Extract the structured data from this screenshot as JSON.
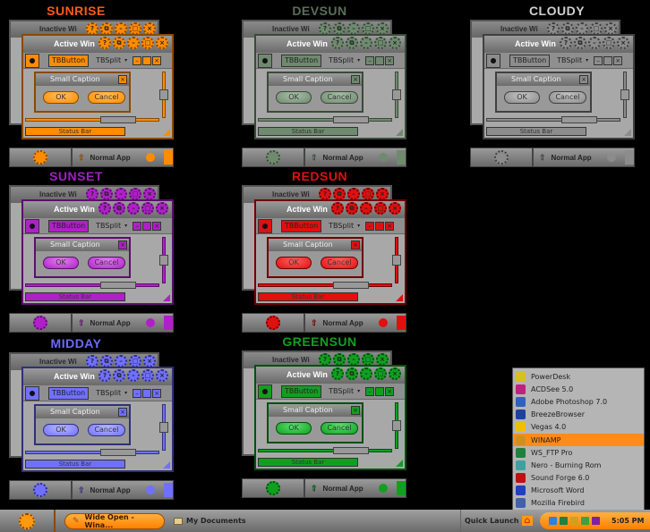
{
  "common": {
    "inactive_title": "Inactive Wi",
    "active_title": "Active Win",
    "tb_button": "TBButton",
    "tb_split": "TBSplit",
    "tb_split_arrow": "▾",
    "small_caption": "Small Caption",
    "ok": "OK",
    "cancel": "Cancel",
    "status_bar": "Status Bar",
    "normal_app": "Normal App",
    "gear_glyphs": [
      "?",
      "⧉",
      "–",
      "□",
      "×"
    ],
    "mini_glyphs": [
      "–",
      "",
      "×"
    ],
    "dialog_close": "×",
    "up_arrow": "⇧",
    "scroll_h_left": "⇦",
    "scroll_h_right": "⇨"
  },
  "themes": [
    {
      "name": "SUNRISE",
      "accent": "#ff8c00",
      "accent_light": "#ffc060",
      "accent_dark": "#8a4a00",
      "title_color": "#ff5a1a"
    },
    {
      "name": "DEVSUN",
      "accent": "#6f8a6f",
      "accent_light": "#a8c0a8",
      "accent_dark": "#3a4a3a",
      "title_color": "#5a6e5a"
    },
    {
      "name": "CLOUDY",
      "accent": "#8c8c8c",
      "accent_light": "#c4c4c4",
      "accent_dark": "#404040",
      "title_color": "#d0d0d0"
    },
    {
      "name": "SUNSET",
      "accent": "#b020c8",
      "accent_light": "#e080f0",
      "accent_dark": "#5a106a",
      "title_color": "#a020c0"
    },
    {
      "name": "REDSUN",
      "accent": "#e01010",
      "accent_light": "#ff6060",
      "accent_dark": "#700000",
      "title_color": "#e01010"
    },
    {
      "name": "MIDDAY",
      "accent": "#7070ff",
      "accent_light": "#b8b8ff",
      "accent_dark": "#30307a",
      "title_color": "#6a6aff"
    },
    {
      "name": "GREENSUN",
      "accent": "#10a020",
      "accent_light": "#60e070",
      "accent_dark": "#005010",
      "title_color": "#10a020"
    }
  ],
  "start_menu": {
    "items": [
      {
        "label": "PowerDesk",
        "icon": "powerdesk-icon",
        "color": "#d8c020"
      },
      {
        "label": "ACDSee 5.0",
        "icon": "acdsee-icon",
        "color": "#c02080"
      },
      {
        "label": "Adobe Photoshop 7.0",
        "icon": "photoshop-icon",
        "color": "#3060c0"
      },
      {
        "label": "BreezeBrowser",
        "icon": "breezebrowser-icon",
        "color": "#2040a0"
      },
      {
        "label": "Vegas 4.0",
        "icon": "vegas-icon",
        "color": "#f0c000"
      },
      {
        "label": "WINAMP",
        "icon": "winamp-icon",
        "color": "#d09020",
        "highlighted": true
      },
      {
        "label": "WS_FTP Pro",
        "icon": "wsftp-icon",
        "color": "#208040"
      },
      {
        "label": "Nero - Burning Rom",
        "icon": "nero-icon",
        "color": "#40a0a0"
      },
      {
        "label": "Sound Forge 6.0",
        "icon": "soundforge-icon",
        "color": "#c01010"
      },
      {
        "label": "Microsoft Word",
        "icon": "word-icon",
        "color": "#2040c0"
      },
      {
        "label": "Mozilla Firebird",
        "icon": "firebird-icon",
        "color": "#4060b0"
      }
    ]
  },
  "taskbar": {
    "active_task": "Wide Open - Wina...",
    "task2": "My Documents",
    "quick_launch": "Quick Launch",
    "home_glyph": "⌂",
    "clock": "5:05 PM",
    "tray_icons": [
      {
        "name": "tray-icon-1",
        "color": "#3080e0"
      },
      {
        "name": "tray-icon-2",
        "color": "#208040"
      },
      {
        "name": "tray-icon-3",
        "color": "#d0a020"
      },
      {
        "name": "tray-icon-4",
        "color": "#40a040"
      },
      {
        "name": "tray-icon-5",
        "color": "#8020a0"
      }
    ]
  }
}
